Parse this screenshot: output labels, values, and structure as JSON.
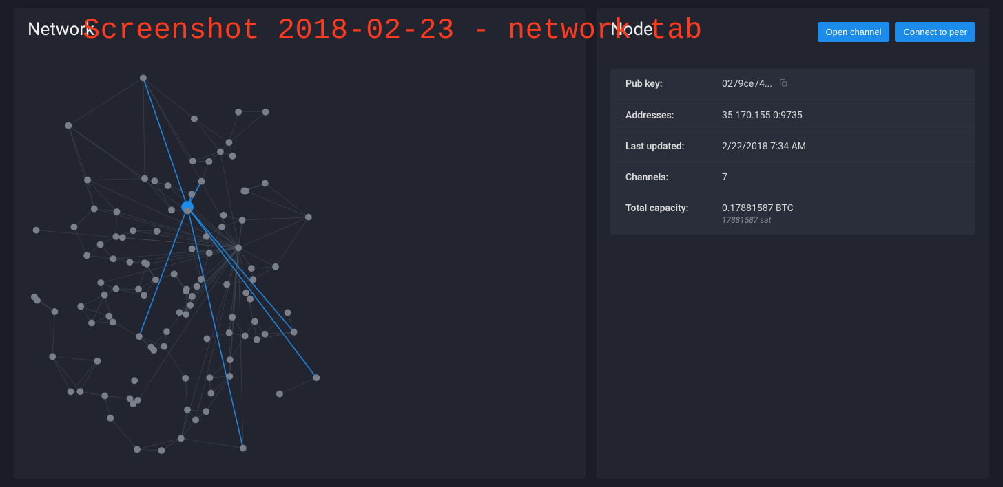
{
  "overlay": "Screenshot 2018-02-23 - network tab",
  "network": {
    "title": "Network"
  },
  "node": {
    "title": "Node",
    "buttons": {
      "open_channel": "Open channel",
      "connect_to_peer": "Connect to peer"
    },
    "info": {
      "pubkey_label": "Pub key:",
      "pubkey_value": "0279ce74...",
      "addresses_label": "Addresses:",
      "addresses_value": "35.170.155.0:9735",
      "last_updated_label": "Last updated:",
      "last_updated_value": "2/22/2018 7:34 AM",
      "channels_label": "Channels:",
      "channels_value": "7",
      "total_capacity_label": "Total capacity:",
      "total_capacity_value": "0.17881587 BTC",
      "total_capacity_sub": "17881587 sat"
    }
  },
  "colors": {
    "node_default": "#7a7f8c",
    "node_selected": "#1b8ceb",
    "edge_default": "#5a5f6c",
    "edge_highlight": "#1b8ceb"
  }
}
